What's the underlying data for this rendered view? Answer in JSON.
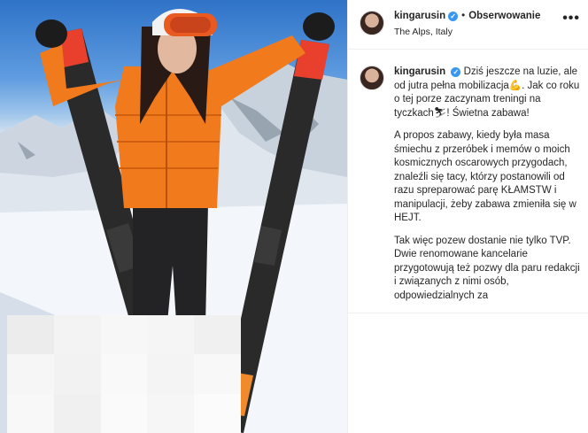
{
  "post": {
    "username": "kingarusin",
    "verified_glyph": "✓",
    "separator": "•",
    "follow_label": "Obserwowanie",
    "location": "The Alps, Italy",
    "more_label": "•••"
  },
  "caption": {
    "username": "kingarusin",
    "paragraphs": [
      "Dziś jeszcze na luzie, ale od jutra pełna mobilizacja💪. Jak co roku o tej porze zaczynam treningi na tyczkach⛷! Świetna zabawa!",
      "A propos zabawy, kiedy była masa śmiechu z przeróbek i memów o moich kosmicznych oscarowych przygodach, znaleźli się tacy, którzy postanowili od razu spreparować parę KŁAMSTW i manipulacji, żeby zabawa zmieniła się w HEJT.",
      "Tak więc pozew dostanie nie tylko TVP. Dwie renomowane kancelarie przygotowują też pozwy dla paru redakcji i związanych z nimi osób, odpowiedzialnych za"
    ]
  },
  "photo": {
    "jacket_color": "#f07a1c",
    "ski_color": "#2a2a2a",
    "ski_accent": "#e8402c",
    "goggle_color": "#e85a20"
  },
  "icons": [
    "verified-badge-icon",
    "more-options-icon",
    "avatar"
  ]
}
